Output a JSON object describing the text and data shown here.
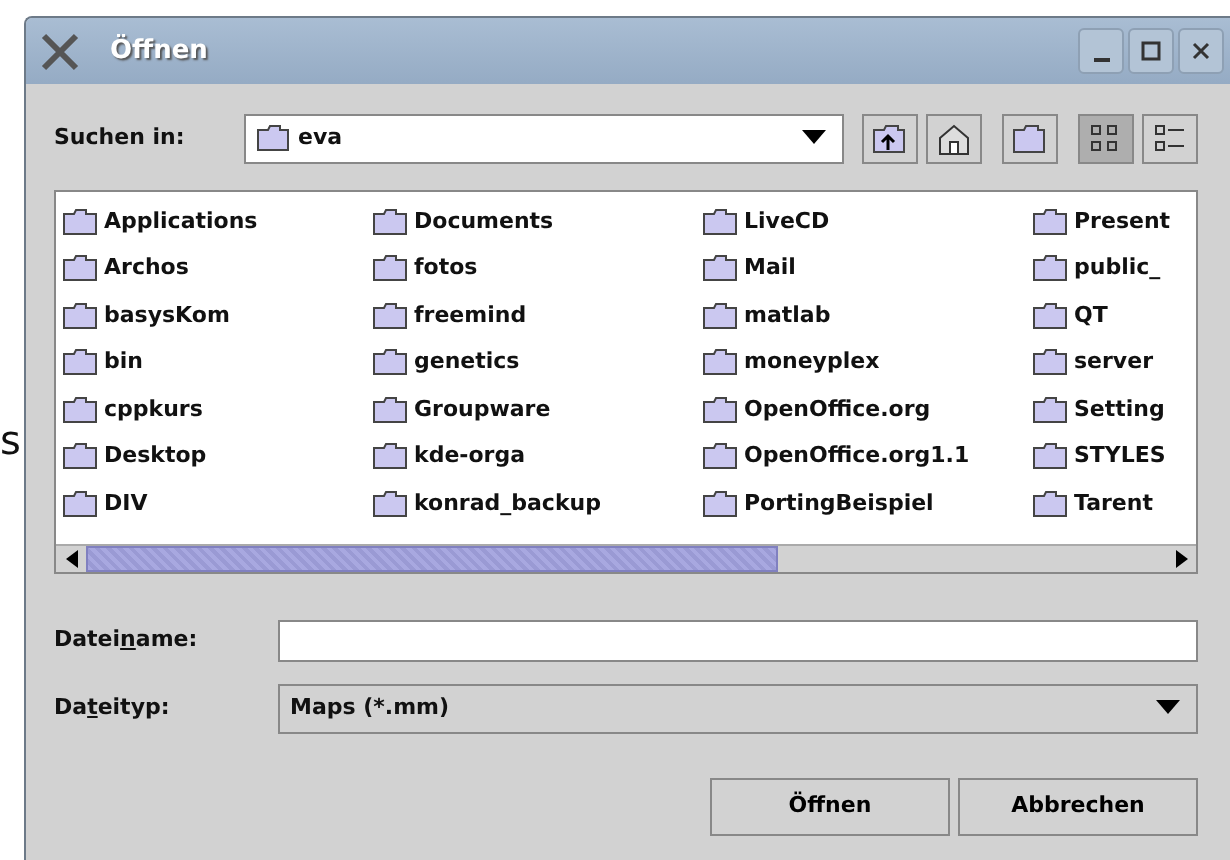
{
  "background_text": "s",
  "window": {
    "title": "Öffnen",
    "controls": [
      {
        "kind": "minimize"
      },
      {
        "kind": "maximize"
      },
      {
        "kind": "close"
      }
    ]
  },
  "look_in": {
    "label": "Suchen in:",
    "value": "eva"
  },
  "toolbar": [
    {
      "kind": "up",
      "selected": false
    },
    {
      "kind": "home",
      "selected": false
    },
    {
      "kind": "new-folder",
      "selected": false
    },
    {
      "kind": "list-view",
      "selected": true
    },
    {
      "kind": "details-view",
      "selected": false
    }
  ],
  "file_columns": [
    [
      "Applications",
      "Archos",
      "basysKom",
      "bin",
      "cppkurs",
      "Desktop",
      "DIV"
    ],
    [
      "Documents",
      "fotos",
      "freemind",
      "genetics",
      "Groupware",
      "kde-orga",
      "konrad_backup"
    ],
    [
      "LiveCD",
      "Mail",
      "matlab",
      "moneyplex",
      "OpenOffice.org",
      "OpenOffice.org1.1",
      "PortingBeispiel"
    ],
    [
      "Present",
      "public_",
      "QT",
      "server",
      "Setting",
      "STYLES",
      "Tarent"
    ]
  ],
  "file_name": {
    "label": [
      "Datei",
      "n",
      "ame:"
    ]
  },
  "file_type": {
    "label": [
      "Da",
      "t",
      "eityp:"
    ],
    "value": "Maps (*.mm)"
  },
  "buttons": [
    "Öffnen",
    "Abbrechen"
  ]
}
